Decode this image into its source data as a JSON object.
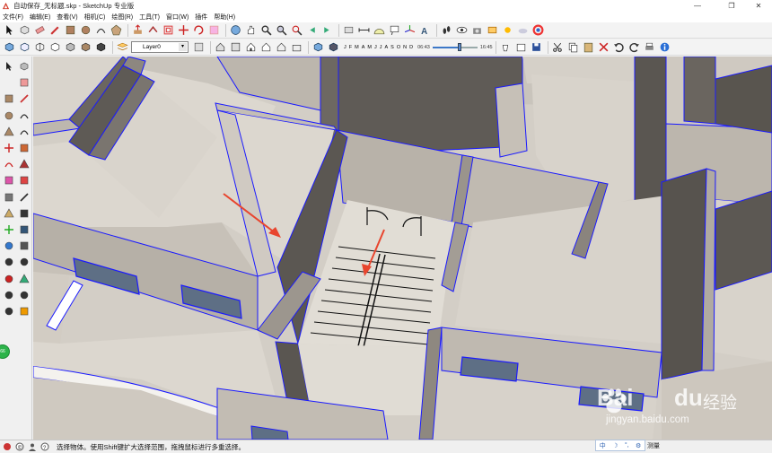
{
  "window": {
    "title": "自动保存_无标题.skp - SketchUp 专业版",
    "controls": [
      "—",
      "❐",
      "✕"
    ]
  },
  "menu": [
    "文件(F)",
    "编辑(E)",
    "查看(V)",
    "相机(C)",
    "绘图(R)",
    "工具(T)",
    "窗口(W)",
    "插件",
    "帮助(H)"
  ],
  "toolbar": {
    "layer_value": "Layer0",
    "months": [
      "J",
      "F",
      "M",
      "A",
      "M",
      "J",
      "J",
      "A",
      "S",
      "O",
      "N",
      "D"
    ],
    "time_start": "06:43",
    "time_end": "16:45",
    "date_slider_fraction": 0.75,
    "time_slider_fraction": 0.6
  },
  "status": {
    "message": "选择物体。使用Shift键扩大选择范围，拖拽鼠标进行多重选择。",
    "ime_items": [
      "中",
      "☽",
      "°,",
      "⚙"
    ],
    "measure_label": "测量"
  },
  "watermark": {
    "brand": "Bai",
    "brand_tail": "du",
    "suffix": "经验",
    "url": "jingyan.baidu.com"
  },
  "colors": {
    "edge": "#1a1aff",
    "floor": "#d8d3cb",
    "wall_dark": "#5e5a55",
    "wall_mid": "#a8a29a",
    "arrow": "#e8452e",
    "accent_green": "#2db34a"
  }
}
